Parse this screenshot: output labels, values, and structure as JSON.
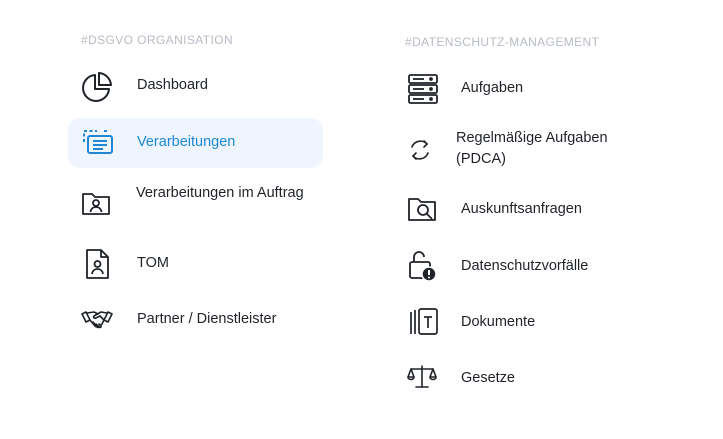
{
  "left": {
    "title": "#DSGVO ORGANISATION",
    "items": [
      {
        "label": "Dashboard",
        "icon": "pie-chart-icon"
      },
      {
        "label": "Verarbeitungen",
        "icon": "list-card-icon",
        "active": true
      },
      {
        "label": "Verarbeitungen im Auftrag",
        "icon": "folder-user-icon"
      },
      {
        "label": "TOM",
        "icon": "document-user-icon"
      },
      {
        "label": "Partner / Dienstleister",
        "icon": "handshake-icon"
      }
    ]
  },
  "right": {
    "title": "#DATENSCHUTZ-MANAGEMENT",
    "items": [
      {
        "label": "Aufgaben",
        "icon": "server-stack-icon"
      },
      {
        "label": "Regelmäßige Aufgaben (PDCA)",
        "icon": "refresh-icon"
      },
      {
        "label": "Auskunftsanfragen",
        "icon": "folder-search-icon"
      },
      {
        "label": "Datenschutzvorfälle",
        "icon": "unlocked-alert-icon"
      },
      {
        "label": "Dokumente",
        "icon": "documents-icon"
      },
      {
        "label": "Gesetze",
        "icon": "scales-icon"
      }
    ]
  },
  "colors": {
    "accent": "#1f87d6",
    "active_bg": "#eef5fe",
    "section_title": "#b7bcc4",
    "text": "#1f2328"
  }
}
